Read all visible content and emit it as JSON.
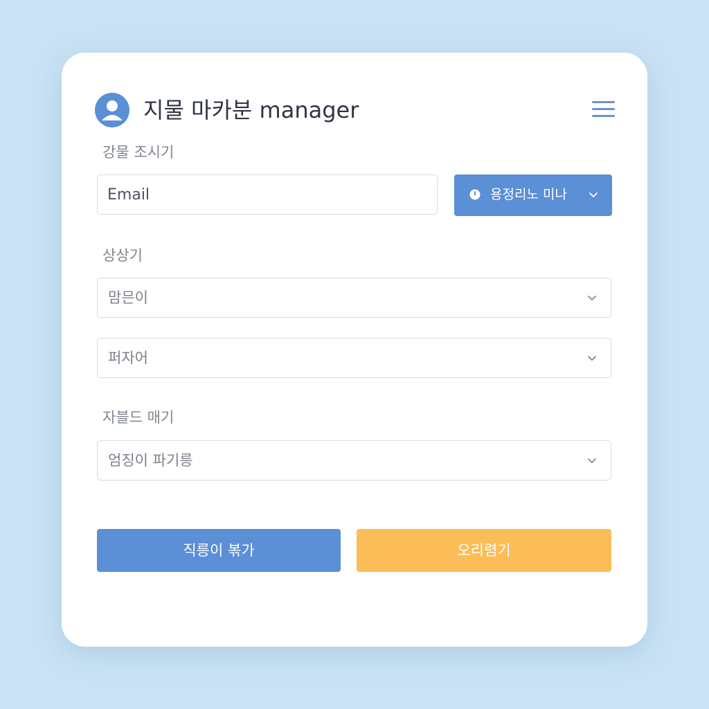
{
  "header": {
    "title": "지물 마카분 manager",
    "avatar_icon": "user-avatar-icon",
    "menu_icon": "hamburger-menu-icon"
  },
  "section1": {
    "label": "강물 조시기",
    "email": {
      "placeholder": "Email",
      "value": ""
    },
    "dropdown": {
      "label": "용정리노 미나",
      "icon": "clock-icon"
    }
  },
  "section2": {
    "label": "상상기",
    "select1": {
      "value": "맘믄이"
    },
    "select2": {
      "value": "퍼자어"
    }
  },
  "section3": {
    "label": "자블드 매기",
    "select": {
      "value": "엄징이 파기릉"
    }
  },
  "actions": {
    "primary_label": "직릉이 볶가",
    "secondary_label": "오리렴기"
  },
  "colors": {
    "background": "#c9e3f4",
    "card": "#ffffff",
    "accent_blue": "#5b8fd6",
    "accent_orange": "#fbbd55",
    "border": "#d6dbe1"
  }
}
